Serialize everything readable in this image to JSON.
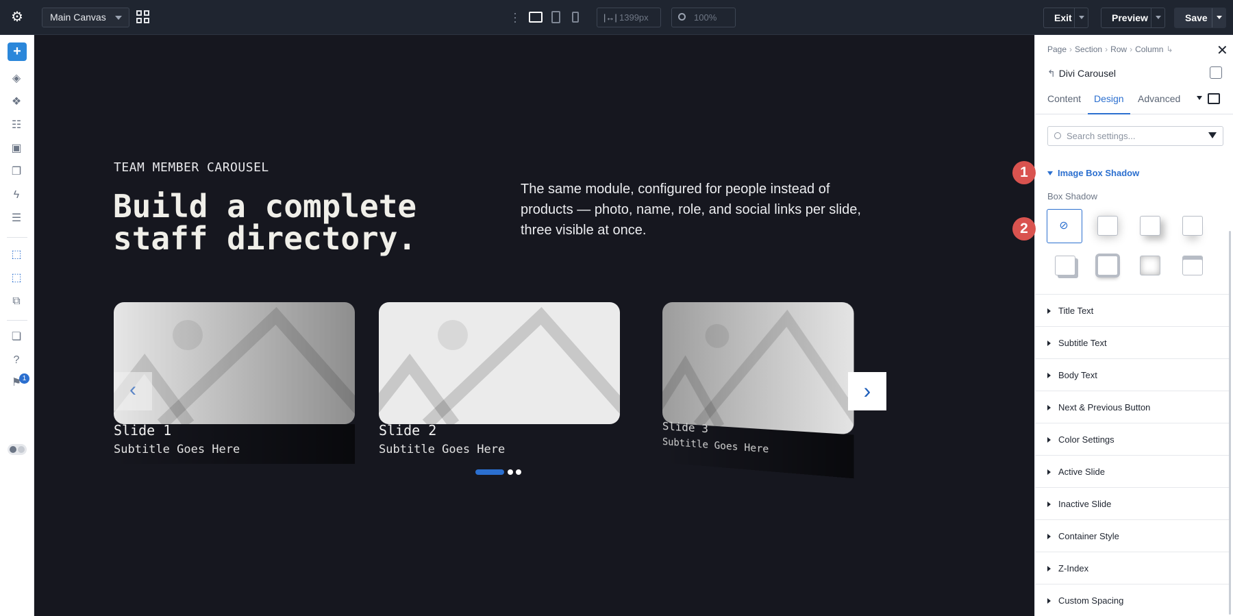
{
  "topbar": {
    "canvas_select": "Main Canvas",
    "width_value": "1399px",
    "zoom_value": "100%",
    "exit_label": "Exit",
    "preview_label": "Preview",
    "save_label": "Save"
  },
  "rail": {
    "notification_count": "1"
  },
  "canvas": {
    "eyebrow": "TEAM MEMBER CAROUSEL",
    "headline": "Build a complete staff directory.",
    "lead": "The same module, configured for people instead of products — photo, name, role, and social links per slide, three visible at once.",
    "slides": [
      {
        "title": "Slide 1",
        "subtitle": "Subtitle Goes Here"
      },
      {
        "title": "Slide 2",
        "subtitle": "Subtitle Goes Here"
      },
      {
        "title": "Slide 3",
        "subtitle": "Subtitle Goes Here"
      }
    ],
    "prev_glyph": "‹",
    "next_glyph": "›"
  },
  "panel": {
    "breadcrumbs": [
      "Page",
      "Section",
      "Row",
      "Column"
    ],
    "module_title": "Divi Carousel",
    "tabs": [
      "Content",
      "Design",
      "Advanced"
    ],
    "active_tab": "Design",
    "search_placeholder": "Search settings...",
    "open_section": "Image Box Shadow",
    "box_shadow_label": "Box Shadow",
    "accordion": [
      "Title Text",
      "Subtitle Text",
      "Body Text",
      "Next & Previous Button",
      "Color Settings",
      "Active Slide",
      "Inactive Slide",
      "Container Style",
      "Z-Index",
      "Custom Spacing"
    ]
  },
  "callouts": [
    "1",
    "2"
  ],
  "colors": {
    "accent": "#2b6fcf",
    "canvas_bg": "#16171f",
    "topbar_bg": "#1f2530",
    "callout": "#d9534f"
  }
}
